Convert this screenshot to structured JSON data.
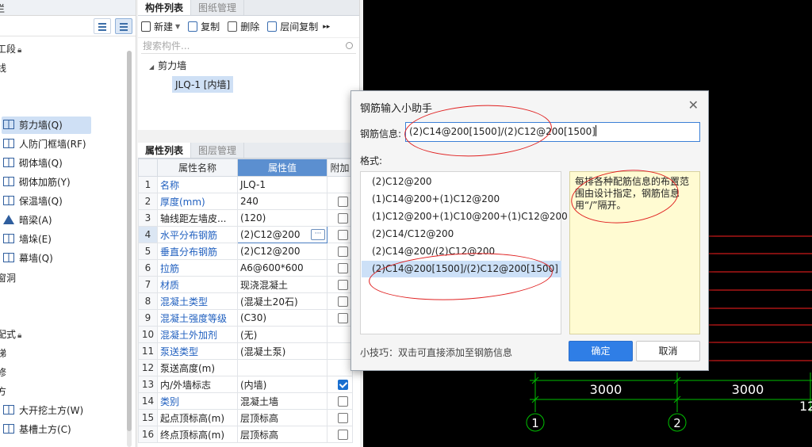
{
  "left_nav": {
    "header": "栏",
    "items": [
      {
        "label": "工段",
        "lock": true
      },
      {
        "label": "线"
      },
      {
        "label": "剪力墙(Q)",
        "selected": true
      },
      {
        "label": "人防门框墙(RF)"
      },
      {
        "label": "砌体墙(Q)"
      },
      {
        "label": "砌体加筋(Y)"
      },
      {
        "label": "保温墙(Q)"
      },
      {
        "label": "暗梁(A)"
      },
      {
        "label": "墙垛(E)"
      },
      {
        "label": "幕墙(Q)"
      },
      {
        "label": "窗洞"
      },
      {
        "label": "配式",
        "lock": true
      },
      {
        "label": "梯"
      },
      {
        "label": "修"
      },
      {
        "label": "方"
      },
      {
        "label": "大开挖土方(W)"
      },
      {
        "label": "基槽土方(C)"
      }
    ]
  },
  "component_panel": {
    "tabs": [
      "构件列表",
      "图纸管理"
    ],
    "toolbar": {
      "new": "新建",
      "copy": "复制",
      "delete": "删除",
      "floor_copy": "层间复制"
    },
    "search_placeholder": "搜索构件...",
    "tree": {
      "group": "剪力墙",
      "item": "JLQ-1 [内墙]"
    }
  },
  "properties_panel": {
    "tabs": [
      "属性列表",
      "图层管理"
    ],
    "headers": {
      "name": "属性名称",
      "value": "属性值",
      "extra": "附加"
    },
    "rows": [
      {
        "no": "1",
        "name": "名称",
        "value": "JLQ-1",
        "blue": true,
        "check": "none"
      },
      {
        "no": "2",
        "name": "厚度(mm)",
        "value": "240",
        "blue": true,
        "check": "off"
      },
      {
        "no": "3",
        "name": "轴线距左墙皮...",
        "value": "(120)",
        "blue": false,
        "check": "off"
      },
      {
        "no": "4",
        "name": "水平分布钢筋",
        "value": "(2)C12@200",
        "blue": true,
        "check": "off",
        "editing": true
      },
      {
        "no": "5",
        "name": "垂直分布钢筋",
        "value": "(2)C12@200",
        "blue": true,
        "check": "off"
      },
      {
        "no": "6",
        "name": "拉筋",
        "value": "A6@600*600",
        "blue": true,
        "check": "off"
      },
      {
        "no": "7",
        "name": "材质",
        "value": "现浇混凝土",
        "blue": true,
        "check": "off"
      },
      {
        "no": "8",
        "name": "混凝土类型",
        "value": "(混凝土20石)",
        "blue": true,
        "check": "off"
      },
      {
        "no": "9",
        "name": "混凝土强度等级",
        "value": "(C30)",
        "blue": true,
        "check": "off"
      },
      {
        "no": "10",
        "name": "混凝土外加剂",
        "value": "(无)",
        "blue": true,
        "check": "none"
      },
      {
        "no": "11",
        "name": "泵送类型",
        "value": "(混凝土泵)",
        "blue": true,
        "check": "none"
      },
      {
        "no": "12",
        "name": "泵送高度(m)",
        "value": "",
        "blue": false,
        "check": "none"
      },
      {
        "no": "13",
        "name": "内/外墙标志",
        "value": "(内墙)",
        "blue": false,
        "check": "on"
      },
      {
        "no": "14",
        "name": "类别",
        "value": "混凝土墙",
        "blue": true,
        "check": "off"
      },
      {
        "no": "15",
        "name": "起点顶标高(m)",
        "value": "层顶标高",
        "blue": false,
        "check": "off"
      },
      {
        "no": "16",
        "name": "终点顶标高(m)",
        "value": "层顶标高",
        "blue": false,
        "check": "off"
      }
    ]
  },
  "dialog": {
    "title": "钢筋输入小助手",
    "info_label": "钢筋信息:",
    "info_value": "(2)C14@200[1500]/(2)C12@200[1500]",
    "format_label": "格式:",
    "formats": [
      "(2)C12@200",
      "(1)C14@200+(1)C12@200",
      "(1)C12@200+(1)C10@200+(1)C12@200",
      "(2)C14/C12@200",
      "(2)C14@200/(2)C12@200",
      "(2)C14@200[1500]/(2)C12@200[1500]"
    ],
    "selected_format_index": 5,
    "note": "每排各种配筋信息的布置范围由设计指定，钢筋信息用“/”隔开。",
    "tip": "小技巧：双击可直接添加至钢筋信息",
    "ok_label": "确定",
    "cancel_label": "取消"
  },
  "canvas": {
    "dims": [
      "3000",
      "3000",
      "12"
    ],
    "axes": [
      "1",
      "2"
    ],
    "line_color": "#00c000",
    "red_color": "#ff2020"
  }
}
